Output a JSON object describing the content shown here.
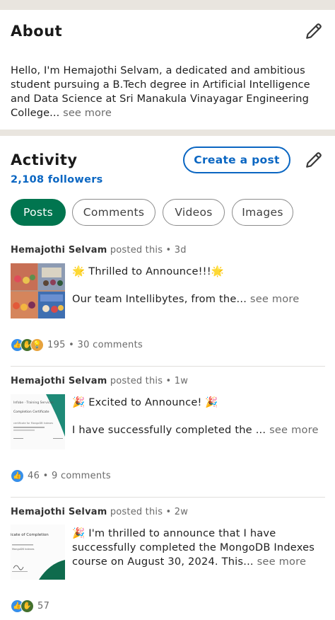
{
  "about": {
    "title": "About",
    "text": "Hello, I'm Hemajothi Selvam, a dedicated and ambitious student pursuing a B.Tech degree in Artificial Intelligence and Data Science at Sri Manakula Vinayagar Engineering College...",
    "see_more": " see more"
  },
  "activity": {
    "title": "Activity",
    "followers": "2,108 followers",
    "create_post": "Create a post",
    "tabs": [
      "Posts",
      "Comments",
      "Videos",
      "Images"
    ],
    "active_tab": "Posts"
  },
  "posts": [
    {
      "author": "Hemajothi Selvam",
      "meta": " posted this • 3d",
      "line1": "🌟 Thrilled to Announce!!!🌟",
      "line2": "Our team Intellibytes, from the...",
      "see_more": " see more",
      "reactions": "195 • 30 comments"
    },
    {
      "author": "Hemajothi Selvam",
      "meta": " posted this • 1w",
      "line1": "🎉 Excited to Announce! 🎉",
      "line2": "I have successfully completed the ...",
      "see_more": " see more",
      "reactions": "46 • 9 comments",
      "thumb_text": {
        "brand": "Infobe · Training Services",
        "heading": "Completion Certificate",
        "body": "certificate for MongoDB Indexes"
      }
    },
    {
      "author": "Hemajothi Selvam",
      "meta": " posted this • 2w",
      "line1": "🎉 I'm thrilled to announce that I have successfully completed the MongoDB Indexes course on August 30, 2024. This...",
      "see_more": " see more",
      "reactions": "57",
      "thumb_text": {
        "heading": "icate of Completion",
        "body": "MongoDB Indexes"
      }
    }
  ],
  "colors": {
    "accent_blue": "#0a66c2",
    "active_green": "#01754f",
    "band": "#e9e5df"
  },
  "icons": [
    "edit-pencil-icon",
    "like-reaction-icon",
    "celebrate-reaction-icon",
    "support-reaction-icon",
    "insightful-reaction-icon"
  ]
}
